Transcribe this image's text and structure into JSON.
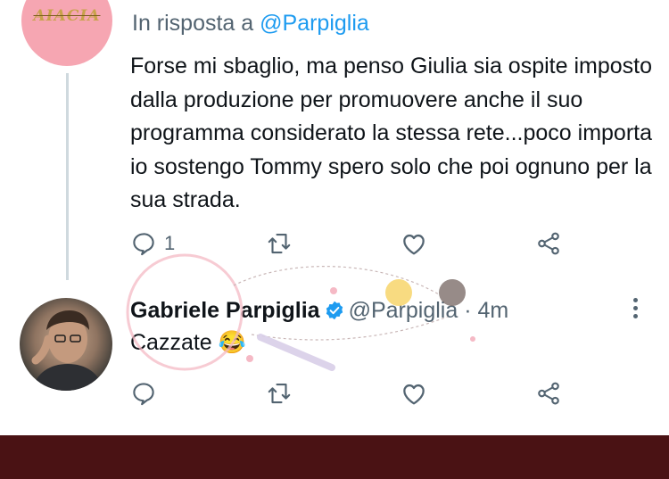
{
  "parent_tweet": {
    "avatar_text": "AIACIA",
    "reply_prefix": "In risposta a",
    "reply_handle": "@Parpiglia",
    "text": "Forse mi sbaglio, ma penso Giulia sia  ospite imposto dalla produzione per promuovere anche il suo programma considerato la stessa rete...poco importa io sostengo Tommy spero solo che poi ognuno per la sua strada.",
    "reply_count": "1"
  },
  "reply_tweet": {
    "name": "Gabriele Parpiglia",
    "handle": "@Parpiglia",
    "separator": "·",
    "time": "4m",
    "text": "Cazzate",
    "emoji": "😂"
  },
  "colors": {
    "accent": "#1d9bf0",
    "secondary_text": "#536471",
    "bottom_bar": "#4a1214"
  },
  "icons": {
    "reply": "reply-icon",
    "retweet": "retweet-icon",
    "like": "heart-icon",
    "share": "share-icon",
    "verified": "verified-badge-icon",
    "more": "more-options-icon"
  }
}
